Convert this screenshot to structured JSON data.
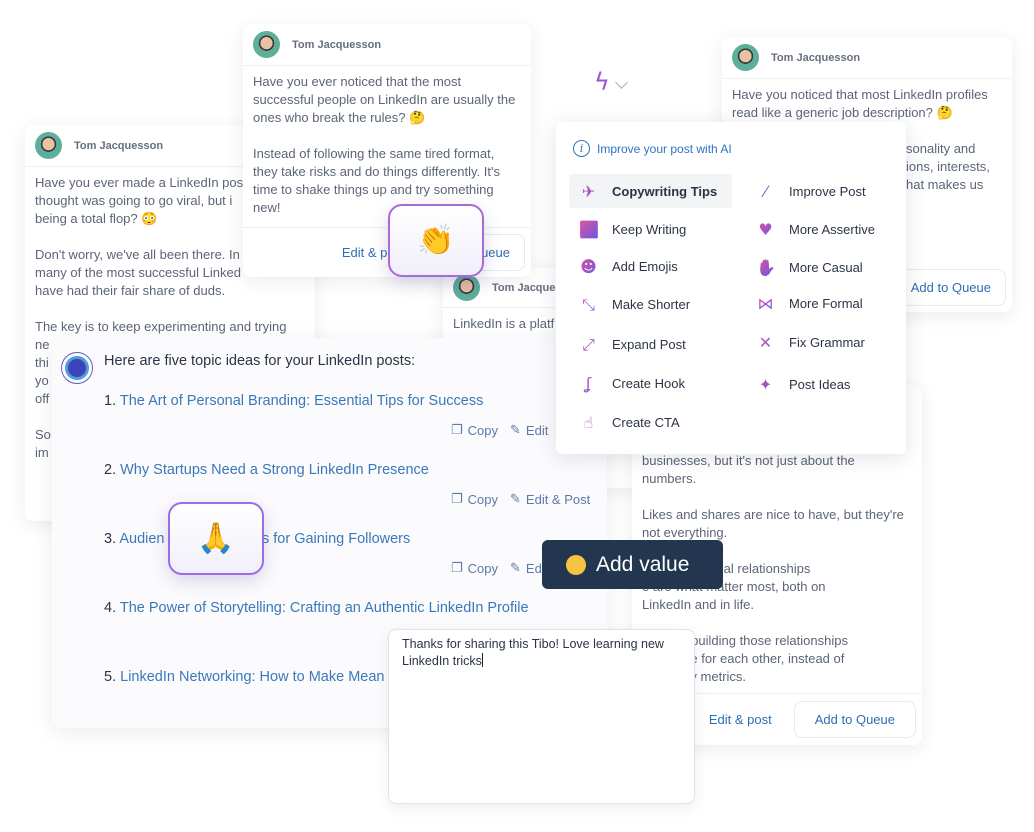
{
  "author": "Tom Jacquesson",
  "cards": {
    "left": {
      "lines": [
        "Have you ever made a LinkedIn pos",
        "thought was going to go viral, but i",
        "being a total flop? 😳",
        "",
        "Don't worry, we've all been there. In",
        "many of the most successful Linked",
        "have had their fair share of duds.",
        "",
        "The key is to keep experimenting and trying",
        "ne",
        "thi",
        "yo",
        "off",
        "",
        "So",
        "im"
      ]
    },
    "top_center": {
      "lines": [
        "Have you ever noticed that the most",
        "successful people on LinkedIn are usually the",
        "ones who break the rules? 🤔",
        "",
        "Instead of following the same tired format,",
        "they take risks and do things differently. It's",
        "time to shake things up and try something",
        "new!"
      ],
      "edit_label": "Edit & post",
      "queue_label": "Add to Queue"
    },
    "middle": {
      "lines": [
        "LinkedIn is a platf"
      ]
    },
    "top_right": {
      "lines": [
        "Have you noticed that most LinkedIn profiles",
        "read like a generic job description? 🤔",
        ""
      ],
      "partial_lines": [
        "sonality and",
        "ions, interests,",
        "hat makes us"
      ],
      "queue_label": "Add to Queue"
    },
    "bottom_right": {
      "lines": [
        "businesses, but it's not just about the",
        "numbers.",
        "",
        "Likes and shares are nice to have, but they're",
        "not everything.",
        "",
        "ections and real relationships",
        "e are what matter most, both on",
        "LinkedIn and in life.",
        "",
        "ocus on building those relationships",
        "ting value for each other, instead of",
        "ing vanity metrics."
      ],
      "edit_label": "Edit & post",
      "queue_label": "Add to Queue"
    }
  },
  "toolbar": {
    "icon": "lightning-icon",
    "dropdown": "chevron-down-icon"
  },
  "ai_menu": {
    "title": "Improve your post with AI",
    "left": [
      {
        "label": "Copywriting Tips",
        "icon": "rocket-icon",
        "selected": true
      },
      {
        "label": "Keep Writing",
        "icon": "fast-forward-icon"
      },
      {
        "label": "Add Emojis",
        "icon": "smiley-icon"
      },
      {
        "label": "Make Shorter",
        "icon": "shrink-icon"
      },
      {
        "label": "Expand Post",
        "icon": "expand-icon"
      },
      {
        "label": "Create Hook",
        "icon": "hook-icon"
      },
      {
        "label": "Create CTA",
        "icon": "tap-icon"
      }
    ],
    "right": [
      {
        "label": "Improve Post",
        "icon": "magic-wand-icon"
      },
      {
        "label": "More Assertive",
        "icon": "flexed-bicep-icon"
      },
      {
        "label": "More Casual",
        "icon": "waving-hand-icon"
      },
      {
        "label": "More Formal",
        "icon": "bow-tie-icon"
      },
      {
        "label": "Fix Grammar",
        "icon": "tools-icon"
      },
      {
        "label": "Post Ideas",
        "icon": "lightbulb-icon"
      }
    ]
  },
  "topics": {
    "header": "Here are five topic ideas for your LinkedIn posts:",
    "items": [
      {
        "num": "1.",
        "title": "The Art of Personal Branding: Essential Tips for Success",
        "actions": [
          "Copy",
          "Edit"
        ]
      },
      {
        "num": "2.",
        "title": "Why Startups Need a Strong LinkedIn Presence",
        "actions": [
          "Copy",
          "Edit & Post"
        ]
      },
      {
        "num": "3.",
        "title": "Audien                    : Best Practices for Gaining Followers",
        "actions": [
          "Copy",
          "Ed"
        ]
      },
      {
        "num": "4.",
        "title": "The Power of Storytelling: Crafting an Authentic LinkedIn Profile"
      },
      {
        "num": "5.",
        "title": "LinkedIn Networking: How to Make Mean"
      }
    ]
  },
  "reactions": {
    "clap": "👏",
    "pray": "🙏"
  },
  "add_value": {
    "label": "Add value",
    "icon": "nerd-face-icon"
  },
  "comment": {
    "value": "Thanks for sharing this Tibo! Love learning new LinkedIn tricks"
  },
  "colors": {
    "link": "#3b78b9",
    "accent": "#2f72c2",
    "pill": "#233650",
    "gradient_start": "#e0559a",
    "gradient_end": "#6a55e6"
  }
}
